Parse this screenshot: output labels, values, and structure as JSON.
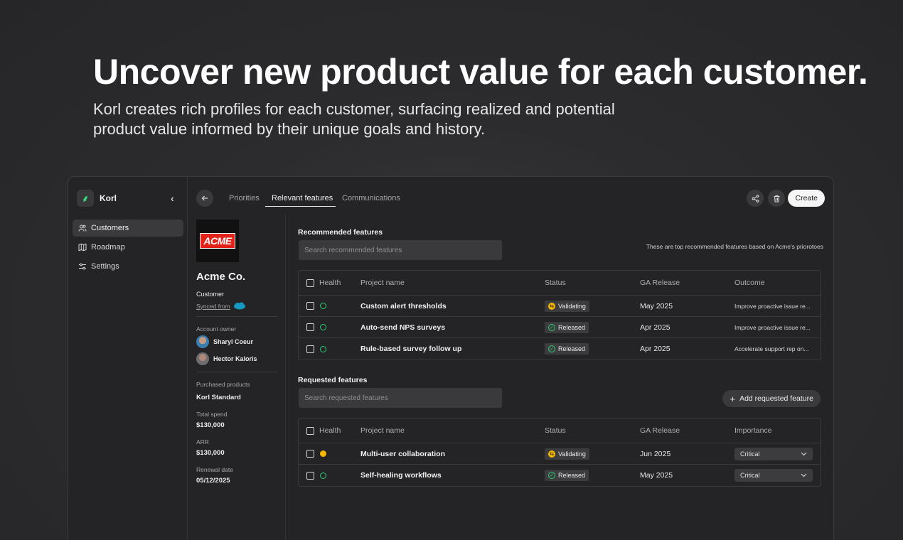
{
  "hero": {
    "title": "Uncover new product value for each customer.",
    "subtitle": "Korl creates rich profiles for each customer, surfacing realized and potential product value informed by their unique goals and history."
  },
  "sidebar": {
    "brand": "Korl",
    "items": [
      {
        "label": "Customers",
        "icon": "users-icon",
        "active": true
      },
      {
        "label": "Roadmap",
        "icon": "map-icon",
        "active": false
      },
      {
        "label": "Settings",
        "icon": "sliders-icon",
        "active": false
      }
    ]
  },
  "tabs": [
    "Priorities",
    "Relevant features",
    "Communications"
  ],
  "active_tab": "Relevant features",
  "toolbar": {
    "create_label": "Create"
  },
  "profile": {
    "logo_text": "ACME",
    "name": "Acme Co.",
    "type": "Customer",
    "synced_label": "Synced from",
    "account_owner_label": "Account owner",
    "owners": [
      "Sharyl Coeur",
      "Hector Kaloris"
    ],
    "purchased_label": "Purchased products",
    "purchased_value": "Korl Standard",
    "total_spend_label": "Total spend",
    "total_spend_value": "$130,000",
    "arr_label": "ARR",
    "arr_value": "$130,000",
    "renewal_label": "Renewal date",
    "renewal_value": "05/12/2025"
  },
  "recommended": {
    "title": "Recommended features",
    "search_placeholder": "Search recommended features",
    "hint": "These are top recommended features based on Acme's priorotoes",
    "columns": [
      "Health",
      "Project name",
      "Status",
      "GA Release",
      "Outcome"
    ],
    "rows": [
      {
        "health": "green",
        "name": "Custom alert thresholds",
        "status": "Validating",
        "ga": "May 2025",
        "outcome": "Improve proactive issue re..."
      },
      {
        "health": "green",
        "name": "Auto-send NPS surveys",
        "status": "Released",
        "ga": "Apr 2025",
        "outcome": "Improve proactive issue re..."
      },
      {
        "health": "green",
        "name": "Rule-based survey follow up",
        "status": "Released",
        "ga": "Apr 2025",
        "outcome": "Accelerate support rep on..."
      }
    ]
  },
  "requested": {
    "title": "Requested features",
    "search_placeholder": "Search requested features",
    "add_label": "Add requested feature",
    "columns": [
      "Health",
      "Project name",
      "Status",
      "GA Release",
      "Importance"
    ],
    "rows": [
      {
        "health": "yellow",
        "name": "Multi-user collaboration",
        "status": "Validating",
        "ga": "Jun 2025",
        "importance": "Critical"
      },
      {
        "health": "green",
        "name": "Self-healing workflows",
        "status": "Released",
        "ga": "May 2025",
        "importance": "Critical"
      }
    ]
  },
  "colors": {
    "accent_green": "#2ecc71",
    "warning_yellow": "#f5b800",
    "acme_red": "#e2231a"
  }
}
